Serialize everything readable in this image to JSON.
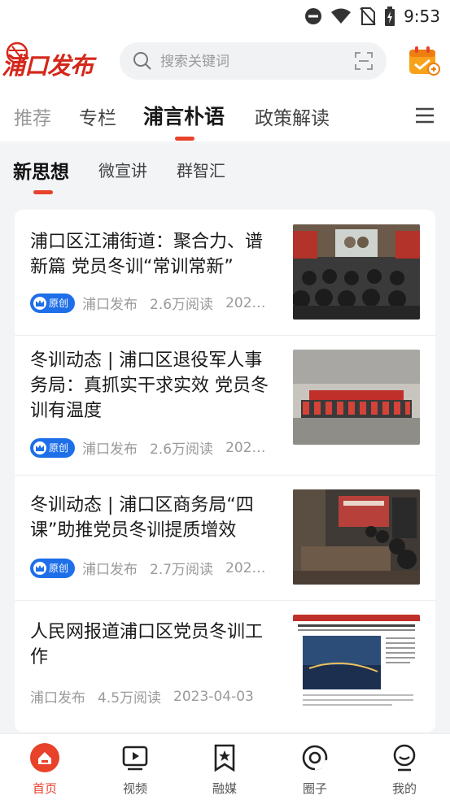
{
  "status_bar": {
    "time": "9:53"
  },
  "header": {
    "logo_text": "浦口发布",
    "search_placeholder": "搜索关键词"
  },
  "tabs": [
    {
      "label": "推荐"
    },
    {
      "label": "专栏"
    },
    {
      "label": "浦言朴语"
    },
    {
      "label": "政策解读"
    }
  ],
  "subtabs": [
    {
      "label": "新思想"
    },
    {
      "label": "微宣讲"
    },
    {
      "label": "群智汇"
    }
  ],
  "articles": [
    {
      "title": "浦口区江浦街道：聚合力、谱新篇 党员冬训“常训常新”",
      "badge": "原创",
      "source": "浦口发布",
      "reads": "2.6万阅读",
      "date": "2024…"
    },
    {
      "title": "冬训动态 | 浦口区退役军人事务局：真抓实干求实效 党员冬训有温度",
      "badge": "原创",
      "source": "浦口发布",
      "reads": "2.6万阅读",
      "date": "2024…"
    },
    {
      "title": "冬训动态 | 浦口区商务局“四课”助推党员冬训提质增效",
      "badge": "原创",
      "source": "浦口发布",
      "reads": "2.7万阅读",
      "date": "2024…"
    },
    {
      "title": "人民网报道浦口区党员冬训工作",
      "source": "浦口发布",
      "reads": "4.5万阅读",
      "date": "2023-04-03"
    }
  ],
  "bottom_nav": [
    {
      "label": "首页",
      "icon": "home-icon"
    },
    {
      "label": "视频",
      "icon": "video-icon"
    },
    {
      "label": "融媒",
      "icon": "bookmark-star-icon"
    },
    {
      "label": "圈子",
      "icon": "circle-icon"
    },
    {
      "label": "我的",
      "icon": "profile-icon"
    }
  ],
  "colors": {
    "accent": "#e8422b",
    "badge_blue": "#1e6fe8",
    "logo_red": "#d5271b"
  }
}
